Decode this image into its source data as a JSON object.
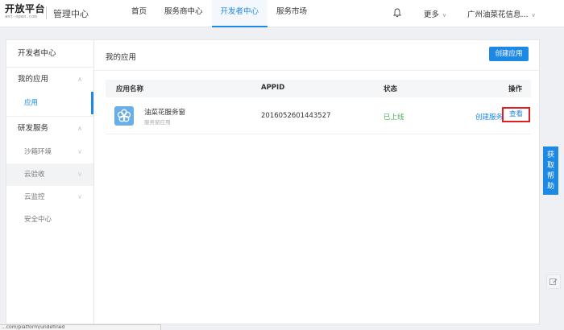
{
  "header": {
    "logo_main": "开放平台",
    "logo_sub": "ant-open.com",
    "admin_center": "管理中心",
    "nav": [
      {
        "label": "首页"
      },
      {
        "label": "服务商中心"
      },
      {
        "label": "开发者中心",
        "active": true
      },
      {
        "label": "服务市场"
      }
    ],
    "more": "更多",
    "company": "广州油菜花信息..."
  },
  "sidebar": {
    "title": "开发者中心",
    "groups": [
      {
        "label": "我的应用",
        "items": [
          {
            "label": "应用",
            "active": true
          }
        ]
      },
      {
        "label": "研发服务",
        "items": [
          {
            "label": "沙箱环境"
          },
          {
            "label": "云验收"
          },
          {
            "label": "云监控"
          },
          {
            "label": "安全中心"
          }
        ]
      }
    ]
  },
  "main": {
    "title": "我的应用",
    "create_button": "创建应用",
    "table": {
      "headers": [
        "应用名称",
        "APPID",
        "状态",
        "操作"
      ],
      "rows": [
        {
          "name": "油菜花服务窗",
          "type": "服务窗应用",
          "appid": "2016052601443527",
          "status": "已上线",
          "action_create": "创建服务",
          "action_view": "查看"
        }
      ]
    }
  },
  "float": {
    "help": "获取帮助"
  },
  "status_bar": {
    "url": "...com/platform/undefined"
  },
  "colors": {
    "accent": "#1e88e5",
    "status_online": "#4caf50",
    "highlight_box": "#e02020"
  }
}
